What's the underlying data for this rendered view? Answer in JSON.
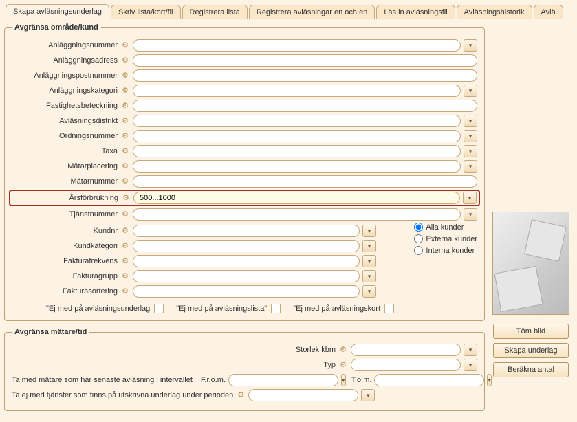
{
  "tabs": [
    "Skapa avläsningsunderlag",
    "Skriv lista/kort/fil",
    "Registrera lista",
    "Registrera avläsningar en och en",
    "Läs in avläsningsfil",
    "Avläsningshistorik",
    "Avlä"
  ],
  "group1": {
    "legend": "Avgränsa område/kund",
    "rows": {
      "anlaggningsnummer": {
        "label": "Anläggningsnummer",
        "value": ""
      },
      "anlaggningsadress": {
        "label": "Anläggningsadress",
        "value": ""
      },
      "anlaggningspostnr": {
        "label": "Anläggningspostnummer",
        "value": ""
      },
      "anlaggningskategori": {
        "label": "Anläggningskategori",
        "value": ""
      },
      "fastighetsbeteckning": {
        "label": "Fastighetsbeteckning",
        "value": ""
      },
      "avlasningsdistrikt": {
        "label": "Avläsningsdistrikt",
        "value": ""
      },
      "ordningsnummer": {
        "label": "Ordningsnummer",
        "value": ""
      },
      "taxa": {
        "label": "Taxa",
        "value": ""
      },
      "matarplacering": {
        "label": "Mätarplacering",
        "value": ""
      },
      "matarnummer": {
        "label": "Mätarnummer",
        "value": ""
      },
      "arsforbrukning": {
        "label": "Årsförbrukning",
        "value": "500...1000"
      },
      "tjanstnummer": {
        "label": "Tjänstnummer",
        "value": ""
      },
      "kundnr": {
        "label": "Kundnr",
        "value": ""
      },
      "kundkategori": {
        "label": "Kundkategori",
        "value": ""
      },
      "fakturafrekvens": {
        "label": "Fakturafrekvens",
        "value": ""
      },
      "fakturagrupp": {
        "label": "Fakturagrupp",
        "value": ""
      },
      "fakturasortering": {
        "label": "Fakturasortering",
        "value": ""
      }
    },
    "radios": {
      "alla": "Alla kunder",
      "externa": "Externa kunder",
      "interna": "Interna kunder",
      "selected": "alla"
    },
    "checks": {
      "underlag": "\"Ej med på avläsningsunderlag",
      "lista": "\"Ej med på avläsningslista\"",
      "kort": "\"Ej med på avläsningskort"
    }
  },
  "group2": {
    "legend": "Avgränsa mätare/tid",
    "storlek_label": "Storlek kbm",
    "storlek_value": "",
    "typ_label": "Typ",
    "typ_value": "",
    "intervall_label": "Ta med mätare som har senaste avläsning i intervallet",
    "from_label": "F.r.o.m.",
    "from_value": "",
    "tom_label": "T.o.m.",
    "tom_value": "",
    "exclude_label": "Ta ej med tjänster som finns på utskrivna underlag under perioden",
    "exclude_value": ""
  },
  "side": {
    "tom_bild": "Töm bild",
    "skapa": "Skapa underlag",
    "berakna": "Beräkna antal"
  }
}
